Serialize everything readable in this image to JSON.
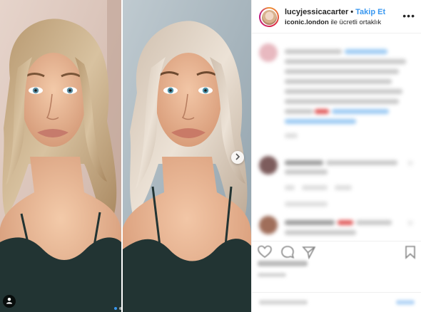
{
  "post": {
    "username": "lucyjessicacarter",
    "separator": "•",
    "follow_label": "Takip Et",
    "partner_name": "iconic.london",
    "partner_suffix": "ile ücretli ortaklık",
    "more_label": "•••"
  },
  "carousel": {
    "current_index": 1,
    "total": 2
  },
  "colors": {
    "accent": "#3897f0",
    "text": "#262626",
    "border": "#efefef",
    "hair": "#c9b59f",
    "skin": "#e8bca0",
    "top": "#223433"
  },
  "icons": [
    "chevron-right-icon",
    "user-tag-icon",
    "more-options-icon",
    "heart-icon",
    "comment-icon",
    "share-icon",
    "bookmark-icon"
  ]
}
